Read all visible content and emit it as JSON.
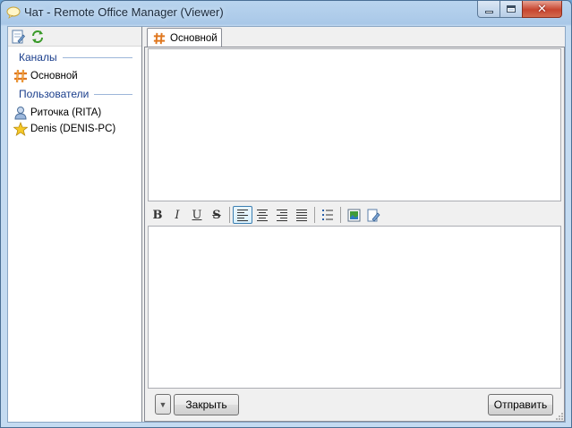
{
  "window": {
    "title": "Чат - Remote Office Manager (Viewer)",
    "icons": {
      "app": "chat-bubble-icon",
      "minimize": "minimize-icon",
      "maximize": "maximize-icon",
      "close": "close-icon"
    }
  },
  "left_toolbar": {
    "icons": [
      "edit-document-icon",
      "refresh-arrows-icon"
    ]
  },
  "sidebar": {
    "channels_header": "Каналы",
    "channels": [
      {
        "label": "Основной",
        "icon": "hash-channel-icon"
      }
    ],
    "users_header": "Пользователи",
    "users": [
      {
        "label": "Риточка (RITA)",
        "icon": "user-icon"
      },
      {
        "label": "Denis (DENIS-PC)",
        "icon": "star-icon"
      }
    ]
  },
  "tabs": [
    {
      "label": "Основной",
      "icon": "hash-channel-icon"
    }
  ],
  "format_toolbar": {
    "bold": "B",
    "italic": "I",
    "underline": "U",
    "strike": "S",
    "icons": [
      "bold-icon",
      "italic-icon",
      "underline-icon",
      "strikethrough-icon",
      "align-left-icon",
      "align-center-icon",
      "align-right-icon",
      "align-justify-icon",
      "bullet-list-icon",
      "insert-image-icon",
      "edit-icon"
    ],
    "active": "align-left"
  },
  "bottom": {
    "close_label": "Закрыть",
    "send_label": "Отправить",
    "dropdown_icon": "chevron-down-icon"
  },
  "colors": {
    "title_bar": "#b9d4ee",
    "close_button": "#c7452f",
    "group_header": "#1a3e8c"
  }
}
